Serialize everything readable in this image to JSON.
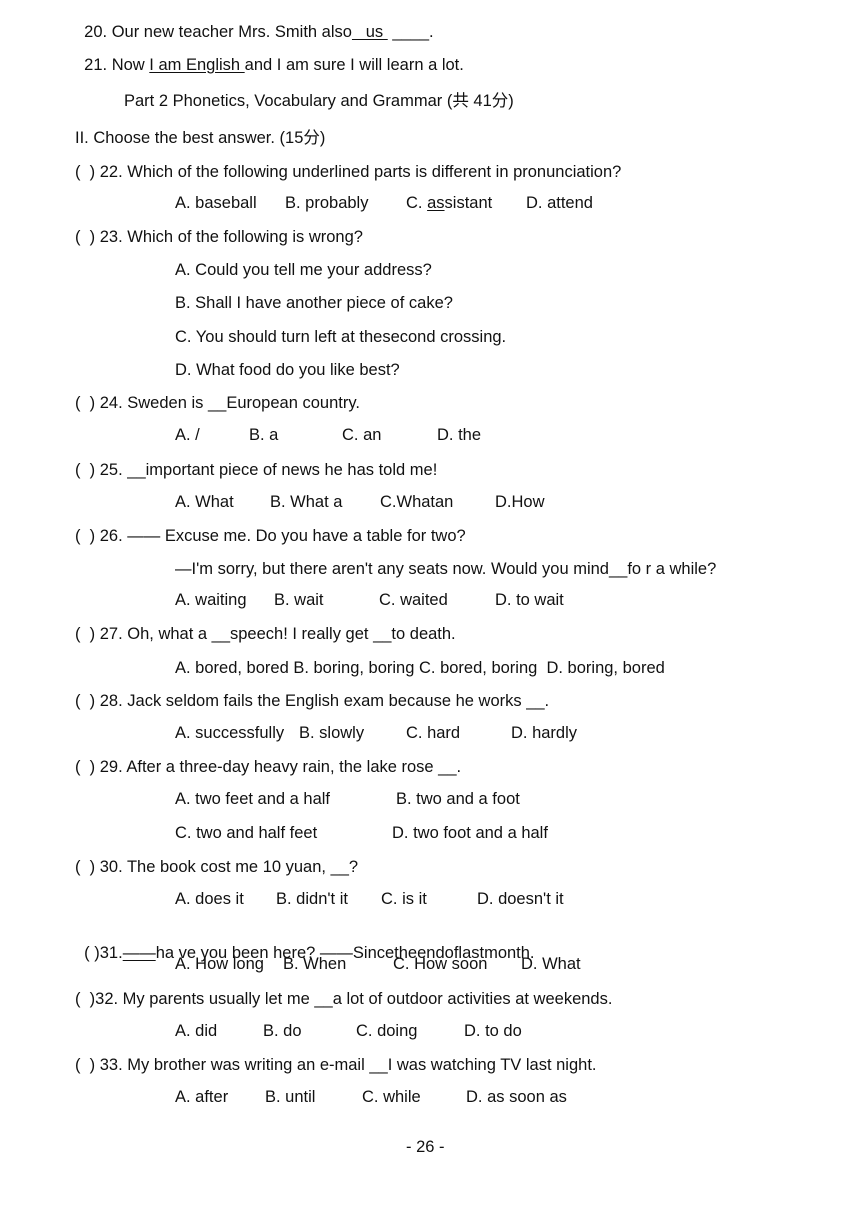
{
  "items": {
    "q20": {
      "pre": "20. Our new teacher Mrs. Smith also",
      "blank1": "   us ",
      "mid": " ",
      "blank2": "____",
      "post": "."
    },
    "q21": {
      "pre": "21. Now ",
      "underlined": "I am English ",
      "post": "and I am sure I will learn a lot."
    }
  },
  "part_title": "Part 2 Phonetics, Vocabulary and Grammar (共 41分)",
  "section_title": "II. Choose the best answer. (15分)",
  "questions": [
    {
      "stem": "(  ) 22. Which of the following underlined parts is different in pronunciation?",
      "options": [
        "A. baseball",
        "B. probably",
        "C. ",
        "D. attend"
      ],
      "option_c_underlined": "as",
      "option_c_rest": "sistant"
    },
    {
      "stem": "(  ) 23. Which of the following is wrong?",
      "options": [
        "A. Could you tell me your address?",
        "B. Shall I have another piece of cake?",
        "C. You should turn left at thesecond crossing.",
        "D. What food do you like best?"
      ]
    },
    {
      "stem": "(  ) 24. Sweden is __European country.",
      "options": [
        "A. /",
        "B. a",
        "C. an",
        "D. the"
      ]
    },
    {
      "stem": "(  ) 25. __important piece of news he has told me!",
      "options": [
        "A. What",
        "B. What a",
        "C.Whatan",
        "D.How"
      ]
    },
    {
      "stem": "(  ) 26. —— Excuse me. Do you have a table for two?",
      "reply": "—I'm sorry, but there aren't any seats now. Would you mind__fo r a while?",
      "options": [
        "A. waiting",
        "B. wait",
        "C. waited",
        "D. to wait"
      ]
    },
    {
      "stem": "(  ) 27. Oh, what a __speech! I really get __to death.",
      "options_line": "A. bored, bored B. boring, boring C. bored, boring  D. boring, bored"
    },
    {
      "stem": "(  ) 28. Jack seldom fails the English exam because he works __.",
      "options": [
        "A. successfully",
        "B. slowly",
        "C. hard",
        "D. hardly"
      ]
    },
    {
      "stem": "(  ) 29. After a three-day heavy rain, the lake rose __.",
      "options": [
        "A. two feet and a half",
        "B. two and a foot",
        "C. two and half feet",
        "D. two foot and a half"
      ]
    },
    {
      "stem": "(  ) 30. The book cost me 10 yuan, __?",
      "options": [
        "A. does it",
        "B. didn't it",
        "C. is it",
        "D. doesn't it"
      ]
    },
    {
      "stem_pre": "( )31.",
      "stem_blank": "——",
      "stem_post": "ha ve you been here? ——Sincetheendoflastmonth.",
      "options": [
        "A. How long",
        "B. When",
        "C. How soon",
        "D. What"
      ]
    },
    {
      "stem": "(  )32. My parents usually let me __a lot of outdoor activities at weekends.",
      "options": [
        "A. did",
        "B. do",
        "C. doing",
        "D. to do"
      ]
    },
    {
      "stem": "(  ) 33. My brother was writing an e-mail __I was watching TV last night.",
      "options": [
        "A. after",
        "B. until",
        "C. while",
        "D. as soon as"
      ]
    }
  ],
  "page_number": "- 26 -"
}
